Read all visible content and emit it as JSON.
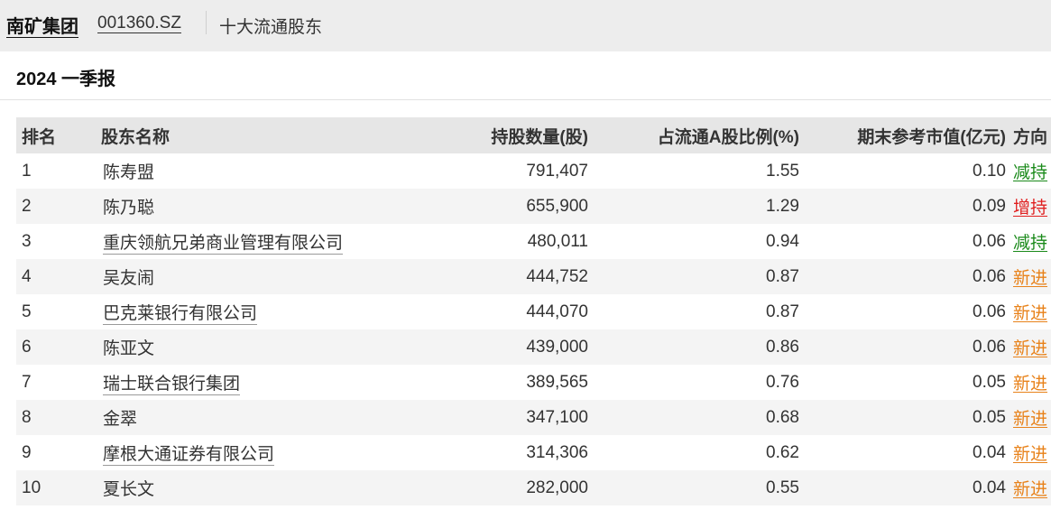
{
  "header": {
    "company": "南矿集团",
    "code": "001360.SZ",
    "section": "十大流通股东"
  },
  "report": {
    "title": "2024 一季报"
  },
  "table": {
    "columns": [
      "排名",
      "股东名称",
      "持股数量(股)",
      "占流通A股比例(%)",
      "期末参考市值(亿元)",
      "方向"
    ],
    "rows": [
      {
        "rank": "1",
        "name": "陈寿盟",
        "name_link": false,
        "shares": "791,407",
        "ratio": "1.55",
        "value": "0.10",
        "direction": "减持",
        "dir_color": "green"
      },
      {
        "rank": "2",
        "name": "陈乃聪",
        "name_link": false,
        "shares": "655,900",
        "ratio": "1.29",
        "value": "0.09",
        "direction": "增持",
        "dir_color": "red"
      },
      {
        "rank": "3",
        "name": "重庆领航兄弟商业管理有限公司",
        "name_link": true,
        "shares": "480,011",
        "ratio": "0.94",
        "value": "0.06",
        "direction": "减持",
        "dir_color": "green"
      },
      {
        "rank": "4",
        "name": "吴友闹",
        "name_link": false,
        "shares": "444,752",
        "ratio": "0.87",
        "value": "0.06",
        "direction": "新进",
        "dir_color": "orange"
      },
      {
        "rank": "5",
        "name": "巴克莱银行有限公司",
        "name_link": true,
        "shares": "444,070",
        "ratio": "0.87",
        "value": "0.06",
        "direction": "新进",
        "dir_color": "orange"
      },
      {
        "rank": "6",
        "name": "陈亚文",
        "name_link": false,
        "shares": "439,000",
        "ratio": "0.86",
        "value": "0.06",
        "direction": "新进",
        "dir_color": "orange"
      },
      {
        "rank": "7",
        "name": "瑞士联合银行集团",
        "name_link": true,
        "shares": "389,565",
        "ratio": "0.76",
        "value": "0.05",
        "direction": "新进",
        "dir_color": "orange"
      },
      {
        "rank": "8",
        "name": "金翠",
        "name_link": false,
        "shares": "347,100",
        "ratio": "0.68",
        "value": "0.05",
        "direction": "新进",
        "dir_color": "orange"
      },
      {
        "rank": "9",
        "name": "摩根大通证券有限公司",
        "name_link": true,
        "shares": "314,306",
        "ratio": "0.62",
        "value": "0.04",
        "direction": "新进",
        "dir_color": "orange"
      },
      {
        "rank": "10",
        "name": "夏长文",
        "name_link": false,
        "shares": "282,000",
        "ratio": "0.55",
        "value": "0.04",
        "direction": "新进",
        "dir_color": "orange"
      }
    ]
  },
  "colors": {
    "increase": "#e02020",
    "decrease": "#1a8a1a",
    "new": "#e8821a"
  }
}
